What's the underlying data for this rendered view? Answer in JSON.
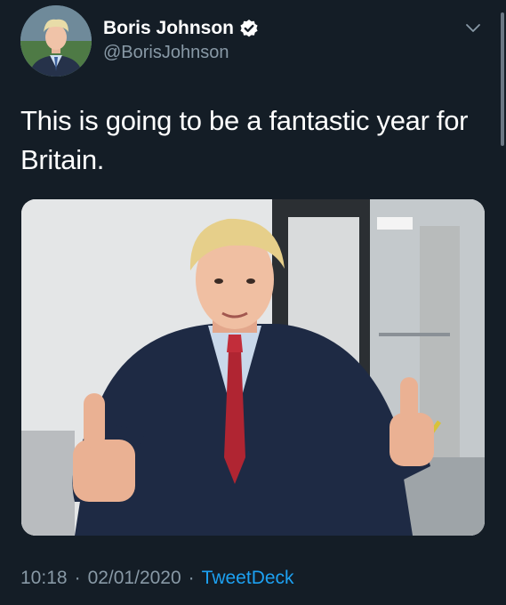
{
  "author": {
    "display_name": "Boris Johnson",
    "handle": "@BorisJohnson",
    "verified": true,
    "avatar_icon": "profile-photo"
  },
  "tweet": {
    "text": "This is going to be a fantastic year for Britain.",
    "image_icon": "photo-man-thumbs-up"
  },
  "meta": {
    "time": "10:18",
    "date": "02/01/2020",
    "separator": "·",
    "source": "TweetDeck"
  },
  "colors": {
    "background": "#141d26",
    "text": "#ffffff",
    "secondary": "#8899a6",
    "link": "#1da1f2"
  }
}
